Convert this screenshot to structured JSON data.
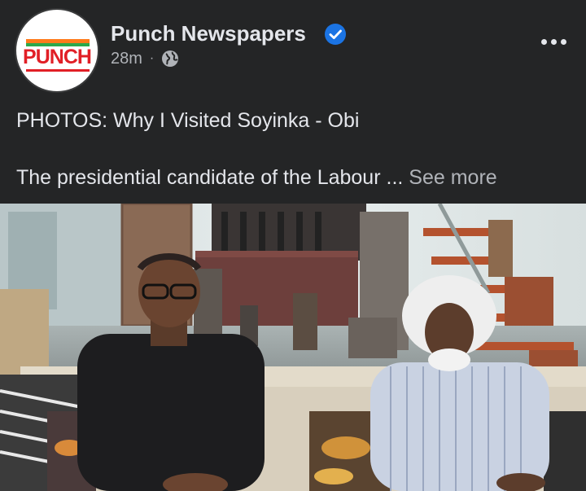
{
  "post": {
    "author": "Punch Newspapers",
    "logo_text": "PUNCH",
    "time": "28m",
    "separator": "·",
    "audience_icon": "globe-icon",
    "verified_icon": "verified-badge-icon",
    "menu_icon": "more-options-icon",
    "headline": "PHOTOS: Why I Visited Soyinka - Obi",
    "excerpt": "The presidential candidate of the Labour",
    "ellipsis": "...",
    "see_more": "See more"
  },
  "colors": {
    "background": "#242526",
    "text_primary": "#e4e6eb",
    "text_secondary": "#b0b3b8",
    "verified_blue": "#1b74e4",
    "logo_red": "#e11f26"
  }
}
